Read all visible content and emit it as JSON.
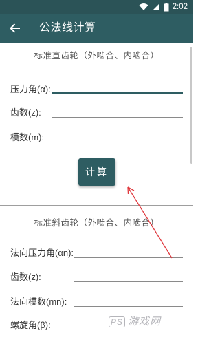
{
  "status_bar": {
    "time": "2:02"
  },
  "app_bar": {
    "title": "公法线计算"
  },
  "spur_section": {
    "title": "标准直齿轮（外啮合、内啮合）",
    "fields": [
      {
        "label": "压力角(α):",
        "value": ""
      },
      {
        "label": "齿数(z):",
        "value": ""
      },
      {
        "label": "模数(m):",
        "value": ""
      }
    ],
    "calc_label": "计算"
  },
  "helical_section": {
    "title": "标准斜齿轮（外啮合、内啮合）",
    "fields": [
      {
        "label": "法向压力角(αn):",
        "value": ""
      },
      {
        "label": "齿数(z):",
        "value": ""
      },
      {
        "label": "法向模数(mn):",
        "value": ""
      },
      {
        "label": "螺旋角(β):",
        "value": ""
      }
    ]
  },
  "watermark": {
    "logo": "PS",
    "text": "游戏网"
  },
  "colors": {
    "app_bar": "#2e5d62",
    "status_bar": "#2b5357",
    "arrow": "#e0393e"
  },
  "icons": [
    "wifi-icon",
    "cellular-icon",
    "battery-icon",
    "back-arrow-icon"
  ]
}
